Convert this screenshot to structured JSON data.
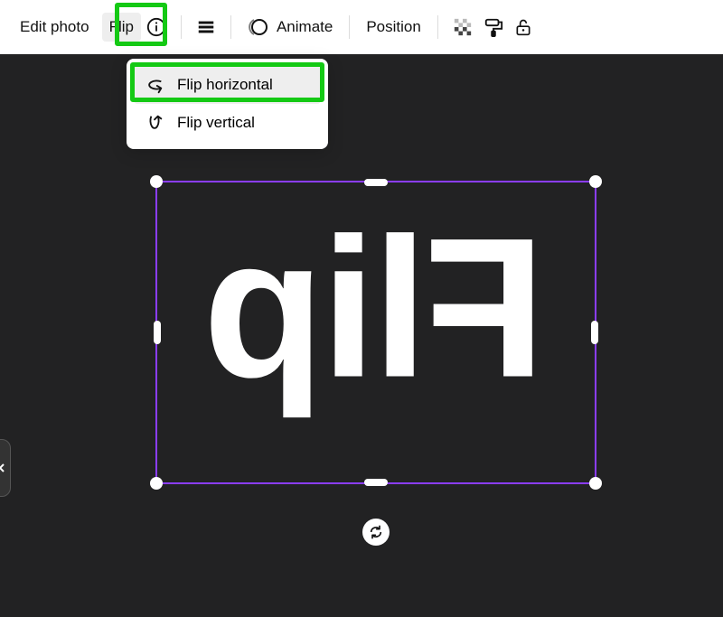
{
  "toolbar": {
    "edit_photo": "Edit photo",
    "flip": "Flip",
    "animate": "Animate",
    "position": "Position"
  },
  "dropdown": {
    "flip_horizontal": "Flip horizontal",
    "flip_vertical": "Flip vertical"
  },
  "canvas": {
    "flipped_text": "Flip"
  }
}
